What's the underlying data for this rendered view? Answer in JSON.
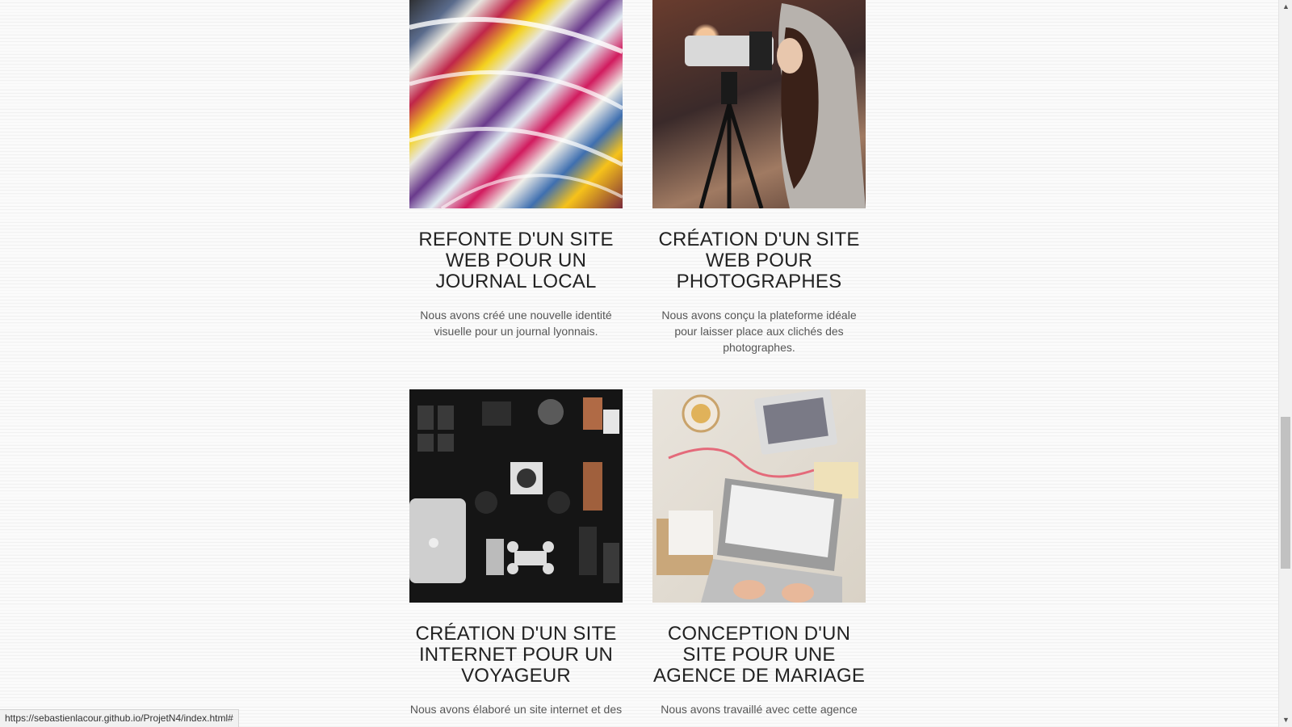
{
  "projects": [
    {
      "image_alt": "magazines",
      "title": "REFONTE D'UN SITE WEB POUR UN JOURNAL LOCAL",
      "description": "Nous avons créé une nouvelle identité visuelle pour un journal lyonnais."
    },
    {
      "image_alt": "photographer",
      "title": "CRÉATION D'UN SITE WEB POUR PHOTOGRAPHES",
      "description": "Nous avons conçu la plateforme idéale pour laisser place aux clichés des photographes."
    },
    {
      "image_alt": "travel gear",
      "title": "CRÉATION D'UN SITE INTERNET POUR UN VOYAGEUR",
      "description": "Nous avons élaboré un site internet et des"
    },
    {
      "image_alt": "wedding agency desk",
      "title": "CONCEPTION D'UN SITE POUR UNE AGENCE DE MARIAGE",
      "description": "Nous avons travaillé avec cette agence"
    }
  ],
  "status_bar": {
    "url": "https://sebastienlacour.github.io/ProjetN4/index.html#"
  }
}
